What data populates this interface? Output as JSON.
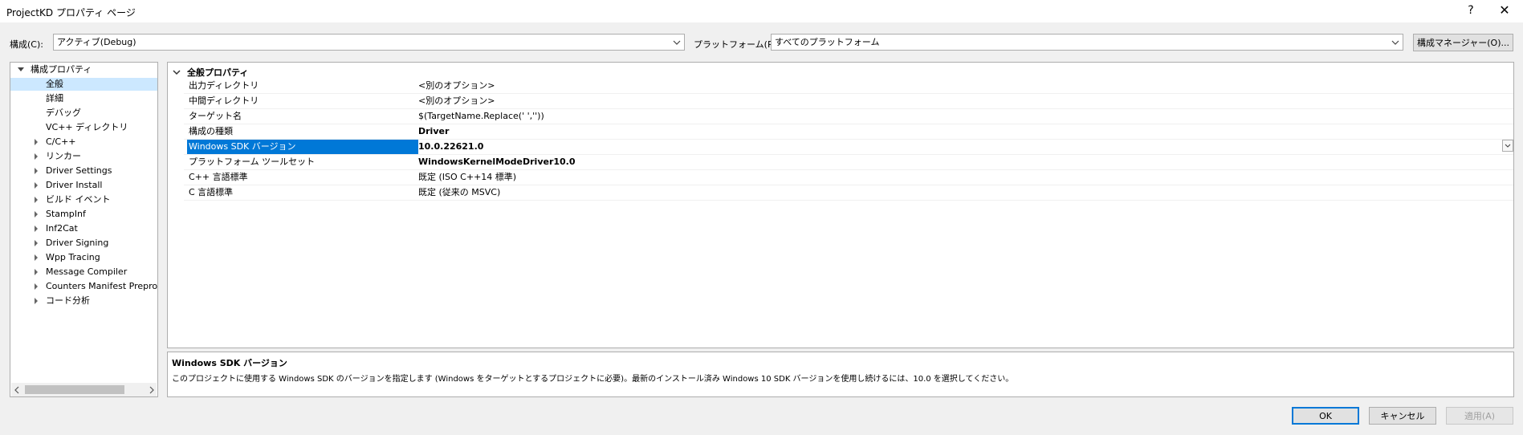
{
  "window": {
    "title": "ProjectKD プロパティ ページ",
    "help_glyph": "?",
    "close_glyph": "✕"
  },
  "config": {
    "config_label": "構成(C):",
    "config_value": "アクティブ(Debug)",
    "platform_label": "プラットフォーム(P):",
    "platform_value": "すべてのプラットフォーム",
    "manager_button": "構成マネージャー(O)..."
  },
  "tree": {
    "root": "構成プロパティ",
    "items": [
      {
        "label": "全般",
        "selected": true,
        "expandable": false
      },
      {
        "label": "詳細",
        "selected": false,
        "expandable": false
      },
      {
        "label": "デバッグ",
        "selected": false,
        "expandable": false
      },
      {
        "label": "VC++ ディレクトリ",
        "selected": false,
        "expandable": false
      },
      {
        "label": "C/C++",
        "selected": false,
        "expandable": true
      },
      {
        "label": "リンカー",
        "selected": false,
        "expandable": true
      },
      {
        "label": "Driver Settings",
        "selected": false,
        "expandable": true
      },
      {
        "label": "Driver Install",
        "selected": false,
        "expandable": true
      },
      {
        "label": "ビルド イベント",
        "selected": false,
        "expandable": true
      },
      {
        "label": "StampInf",
        "selected": false,
        "expandable": true
      },
      {
        "label": "Inf2Cat",
        "selected": false,
        "expandable": true
      },
      {
        "label": "Driver Signing",
        "selected": false,
        "expandable": true
      },
      {
        "label": "Wpp Tracing",
        "selected": false,
        "expandable": true
      },
      {
        "label": "Message Compiler",
        "selected": false,
        "expandable": true
      },
      {
        "label": "Counters Manifest Preproc",
        "selected": false,
        "expandable": true
      },
      {
        "label": "コード分析",
        "selected": false,
        "expandable": true
      }
    ]
  },
  "grid": {
    "category": "全般プロパティ",
    "rows": [
      {
        "name": "出力ディレクトリ",
        "value": "<別のオプション>",
        "bold": false,
        "selected": false
      },
      {
        "name": "中間ディレクトリ",
        "value": "<別のオプション>",
        "bold": false,
        "selected": false
      },
      {
        "name": "ターゲット名",
        "value": "$(TargetName.Replace(' ',''))",
        "bold": false,
        "selected": false
      },
      {
        "name": "構成の種類",
        "value": "Driver",
        "bold": true,
        "selected": false
      },
      {
        "name": "Windows SDK バージョン",
        "value": "10.0.22621.0",
        "bold": true,
        "selected": true
      },
      {
        "name": "プラットフォーム ツールセット",
        "value": "WindowsKernelModeDriver10.0",
        "bold": true,
        "selected": false
      },
      {
        "name": "C++ 言語標準",
        "value": "既定 (ISO C++14 標準)",
        "bold": false,
        "selected": false
      },
      {
        "name": "C 言語標準",
        "value": "既定 (従来の MSVC)",
        "bold": false,
        "selected": false
      }
    ]
  },
  "description": {
    "title": "Windows SDK バージョン",
    "text": "このプロジェクトに使用する Windows SDK のバージョンを指定します (Windows をターゲットとするプロジェクトに必要)。最新のインストール済み Windows 10 SDK バージョンを使用し続けるには、10.0 を選択してください。"
  },
  "buttons": {
    "ok": "OK",
    "cancel": "キャンセル",
    "apply": "適用(A)"
  },
  "colors": {
    "selection": "#0078d7",
    "tree_selection": "#cce8ff",
    "ok_border": "#0078d7"
  }
}
